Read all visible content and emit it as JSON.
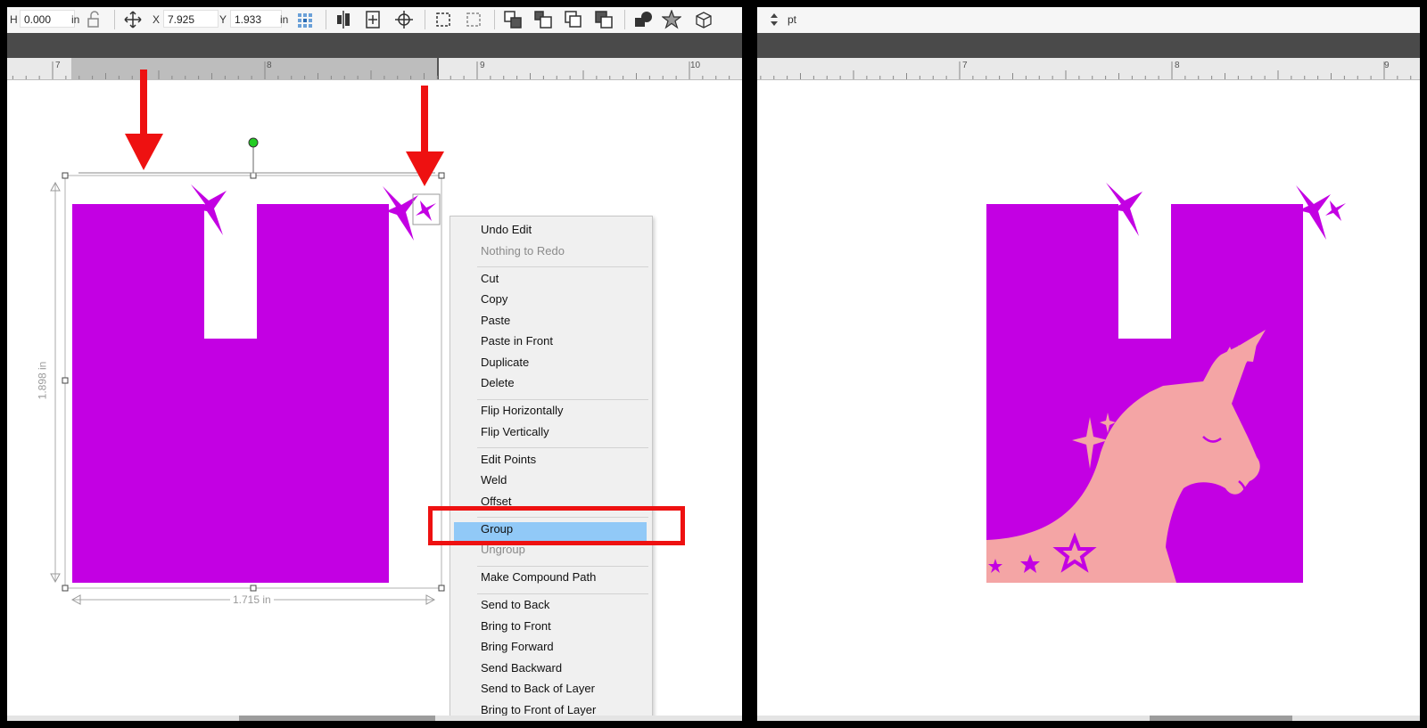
{
  "left": {
    "toolbar": {
      "h_label": "H",
      "h_value": "0.000",
      "h_unit": "in",
      "x_label": "X",
      "x_value": "7.925",
      "y_label": "Y",
      "y_value": "1.933",
      "pos_unit": "in"
    },
    "ruler": [
      "7",
      "8",
      "9",
      "10"
    ],
    "dimensions": {
      "height": "1.898 in",
      "width": "1.715 in"
    },
    "context_menu": {
      "groups": [
        [
          {
            "label": "Undo Edit",
            "enabled": true
          },
          {
            "label": "Nothing to Redo",
            "enabled": false
          }
        ],
        [
          {
            "label": "Cut",
            "enabled": true
          },
          {
            "label": "Copy",
            "enabled": true
          },
          {
            "label": "Paste",
            "enabled": true
          },
          {
            "label": "Paste in Front",
            "enabled": true
          },
          {
            "label": "Duplicate",
            "enabled": true
          },
          {
            "label": "Delete",
            "enabled": true
          }
        ],
        [
          {
            "label": "Flip Horizontally",
            "enabled": true
          },
          {
            "label": "Flip Vertically",
            "enabled": true
          }
        ],
        [
          {
            "label": "Edit Points",
            "enabled": true
          },
          {
            "label": "Weld",
            "enabled": true
          },
          {
            "label": "Offset",
            "enabled": true
          }
        ],
        [
          {
            "label": "Group",
            "enabled": true,
            "highlighted": true
          },
          {
            "label": "Ungroup",
            "enabled": false
          }
        ],
        [
          {
            "label": "Make Compound Path",
            "enabled": true
          }
        ],
        [
          {
            "label": "Send to Back",
            "enabled": true
          },
          {
            "label": "Bring to Front",
            "enabled": true
          },
          {
            "label": "Bring Forward",
            "enabled": true
          },
          {
            "label": "Send Backward",
            "enabled": true
          },
          {
            "label": "Send to Back of Layer",
            "enabled": true
          },
          {
            "label": "Bring to Front of Layer",
            "enabled": true
          }
        ]
      ]
    }
  },
  "right": {
    "toolbar": {
      "unit": "pt"
    },
    "ruler": [
      "7",
      "8",
      "9"
    ]
  },
  "colors": {
    "shape_purple": "#c300e3",
    "unicorn_pink": "#f4a5a5",
    "annotation_red": "#ee1111",
    "menu_highlight": "#91c9f7"
  }
}
